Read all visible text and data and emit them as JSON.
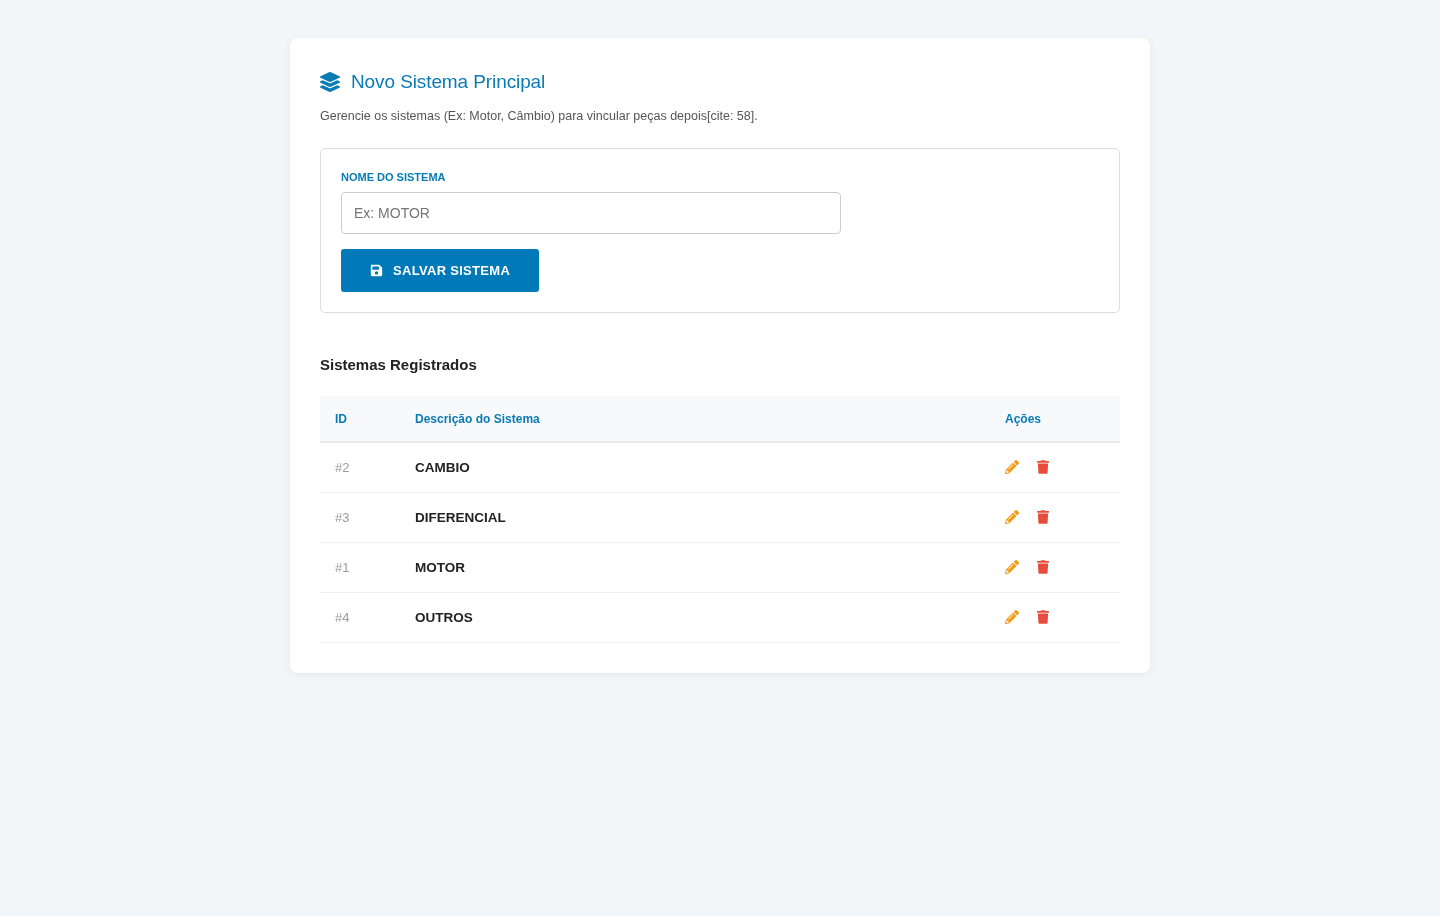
{
  "header": {
    "title": "Novo Sistema Principal",
    "description": "Gerencie os sistemas (Ex: Motor, Câmbio) para vincular peças depois[cite: 58]."
  },
  "form": {
    "label": "NOME DO SISTEMA",
    "placeholder": "Ex: MOTOR",
    "submit_button": "SALVAR SISTEMA"
  },
  "list": {
    "title": "Sistemas Registrados",
    "columns": [
      "ID",
      "Descrição do Sistema",
      "Ações"
    ],
    "rows": [
      {
        "id": "#2",
        "name": "CAMBIO"
      },
      {
        "id": "#3",
        "name": "DIFERENCIAL"
      },
      {
        "id": "#1",
        "name": "MOTOR"
      },
      {
        "id": "#4",
        "name": "OUTROS"
      }
    ]
  }
}
